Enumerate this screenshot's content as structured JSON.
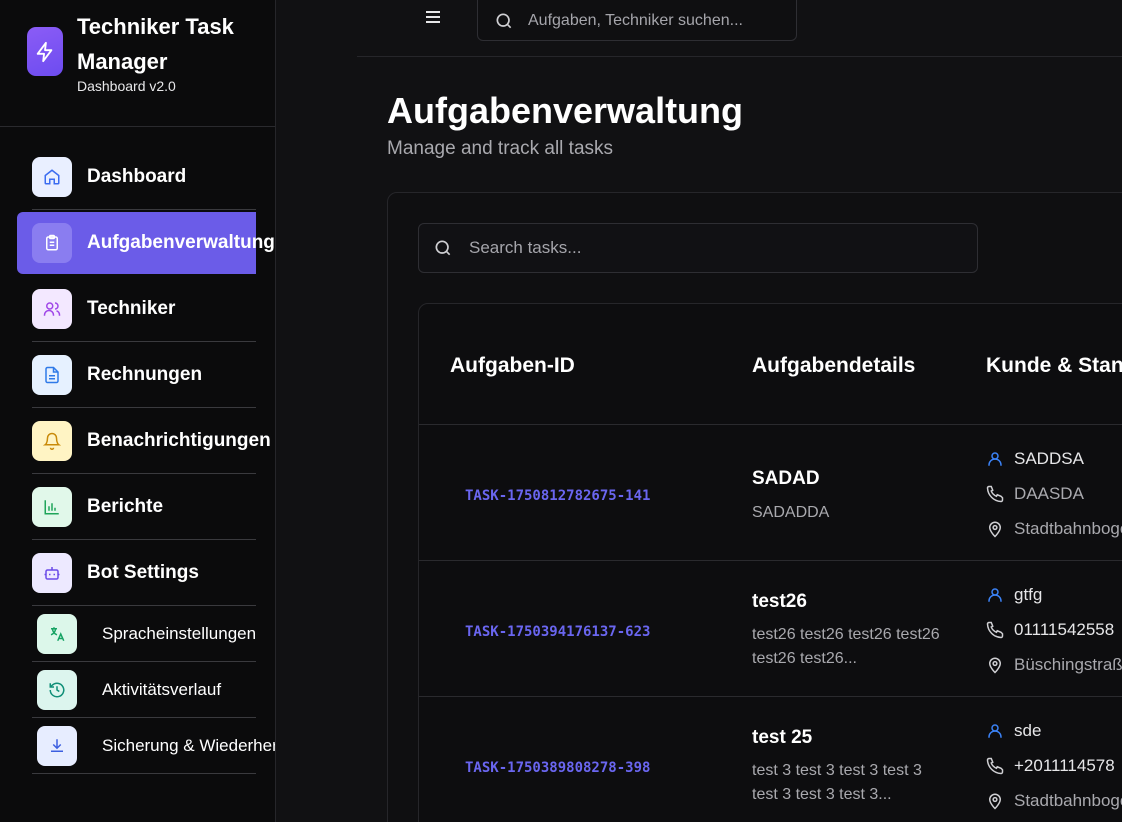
{
  "brand": {
    "title": "Techniker Task Manager",
    "subtitle": "Dashboard v2.0",
    "logo_icon": "lightning-icon",
    "accent": "#7c5cf4"
  },
  "sidebar": {
    "items": [
      {
        "label": "Dashboard",
        "icon": "home-icon",
        "icon_bg": "#e9efff",
        "icon_color": "#3b6cf0"
      },
      {
        "label": "Aufgabenverwaltung",
        "icon": "clipboard-icon",
        "active": true,
        "icon_bg": "#8a7df0",
        "icon_color": "#ffffff"
      },
      {
        "label": "Techniker",
        "icon": "users-icon",
        "icon_bg": "#f3e8ff",
        "icon_color": "#a047e8"
      },
      {
        "label": "Rechnungen",
        "icon": "file-text-icon",
        "icon_bg": "#e6f1ff",
        "icon_color": "#2f7ae8"
      },
      {
        "label": "Benachrichtigungen",
        "icon": "bell-icon",
        "icon_bg": "#fff4c4",
        "icon_color": "#c98a0a"
      },
      {
        "label": "Berichte",
        "icon": "bar-chart-icon",
        "icon_bg": "#e1f8ea",
        "icon_color": "#1fa55a"
      },
      {
        "label": "Bot Settings",
        "icon": "bot-icon",
        "icon_bg": "#ede9ff",
        "icon_color": "#6b4ae8"
      },
      {
        "label": "Spracheinstellungen",
        "icon": "translate-icon",
        "icon_bg": "#dcf7ea",
        "icon_color": "#17a364"
      },
      {
        "label": "Aktivitätsverlauf",
        "icon": "history-icon",
        "icon_bg": "#dcf5ee",
        "icon_color": "#108f78"
      },
      {
        "label": "Sicherung & Wiederherstellung",
        "icon": "download-icon",
        "icon_bg": "#e7edff",
        "icon_color": "#3c5fe0"
      }
    ],
    "active_color": "#6b5ce8"
  },
  "topbar": {
    "menu_icon": "menu-icon",
    "search_placeholder": "Aufgaben, Techniker suchen..."
  },
  "page": {
    "title": "Aufgabenverwaltung",
    "subtitle": "Manage and track all tasks"
  },
  "tasks_search": {
    "placeholder": "Search tasks..."
  },
  "table": {
    "columns": [
      "Aufgaben-ID",
      "Aufgabendetails",
      "Kunde & Standort"
    ],
    "rows": [
      {
        "id": "TASK-1750812782675-141",
        "title": "SADAD",
        "description": "SADADDA",
        "customer": "SADDSA",
        "phone": "DAASDA",
        "location": "Stadtbahnbogen"
      },
      {
        "id": "TASK-1750394176137-623",
        "title": "test26",
        "description": "test26 test26 test26 test26 test26 test26...",
        "customer": "gtfg",
        "phone": "01111542558",
        "location": "Büschingstraße"
      },
      {
        "id": "TASK-1750389808278-398",
        "title": "test 25",
        "description": "test 3 test 3 test 3 test 3 test 3 test 3 test 3...",
        "customer": "sde",
        "phone": "+2011114578",
        "location": "Stadtbahnbogen"
      }
    ],
    "id_color": "#6a66f0"
  }
}
